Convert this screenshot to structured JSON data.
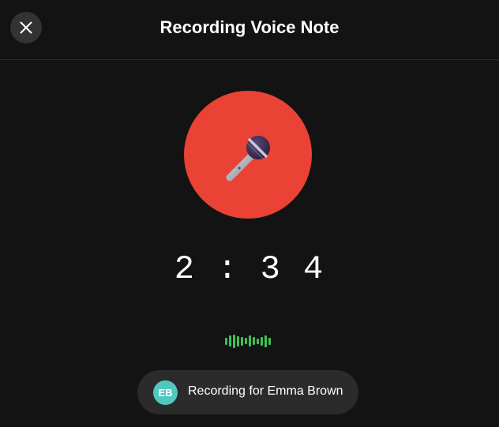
{
  "header": {
    "title": "Recording Voice Note",
    "close_icon": "close-icon"
  },
  "recorder": {
    "button_icon": "microphone-icon",
    "timer": "2:34",
    "accent_color": "#ea4235",
    "waveform_color": "#3fbf56",
    "waveform_levels": [
      0.5,
      0.8,
      0.95,
      0.7,
      0.6,
      0.45,
      0.75,
      0.55,
      0.4,
      0.6,
      0.85,
      0.5
    ]
  },
  "recipient": {
    "initials": "EB",
    "label": "Recording for Emma Brown",
    "avatar_color": "#4fc9c0"
  }
}
